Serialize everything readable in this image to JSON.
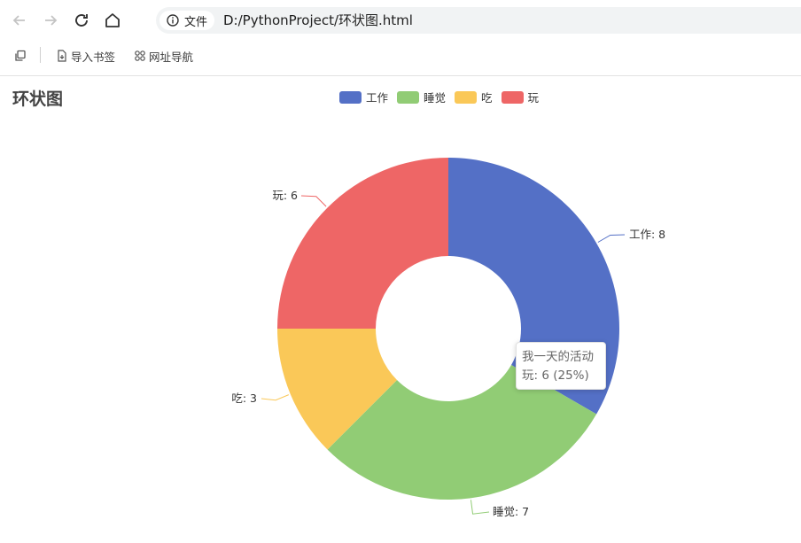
{
  "browser": {
    "url_chip": "文件",
    "url": "D:/PythonProject/环状图.html",
    "bookmarks": [
      {
        "label": "导入书签"
      },
      {
        "label": "网址导航"
      }
    ]
  },
  "page": {
    "title": "环状图"
  },
  "chart_data": {
    "type": "pie",
    "donut": true,
    "title": "环状图",
    "legend_position": "top",
    "categories": [
      "工作",
      "睡觉",
      "吃",
      "玩"
    ],
    "values": [
      8,
      7,
      3,
      6
    ],
    "colors": [
      "#5470c6",
      "#91cc75",
      "#fac858",
      "#ee6666"
    ],
    "series_name": "我一天的活动",
    "slice_labels": [
      "工作: 8",
      "睡觉: 7",
      "吃: 3",
      "玩: 6"
    ],
    "tooltip": {
      "title": "我一天的活动",
      "text": "玩: 6 (25%)"
    }
  }
}
